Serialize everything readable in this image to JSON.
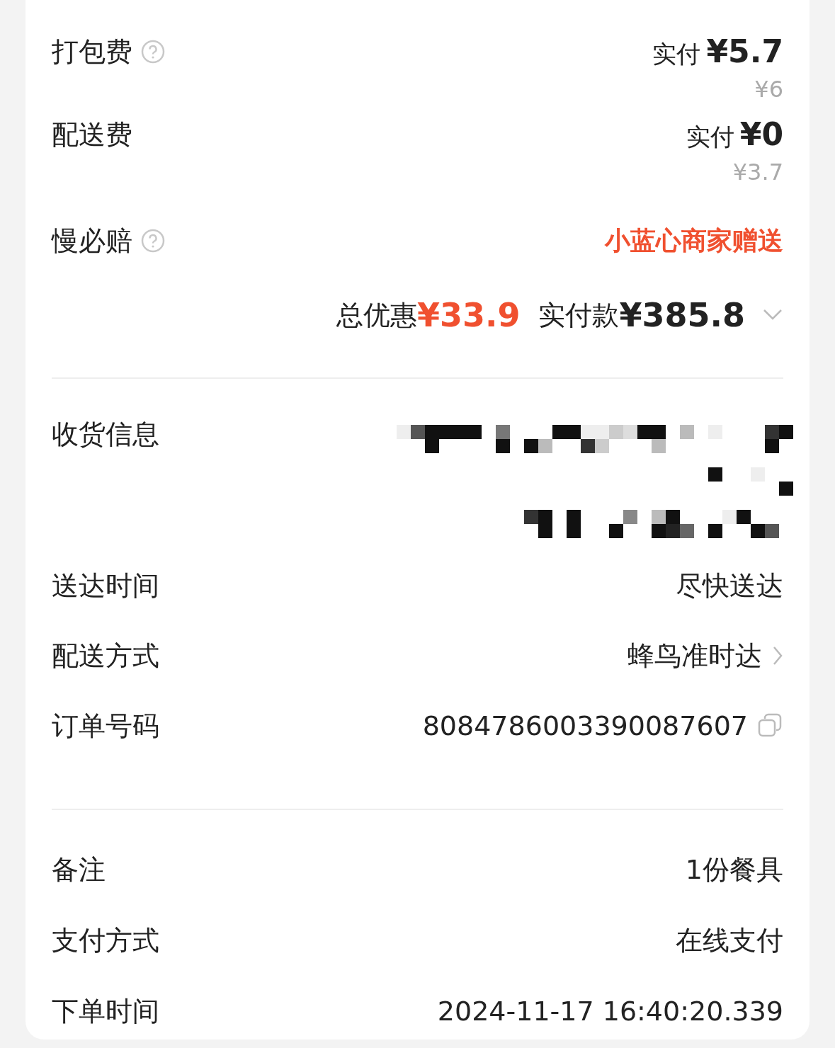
{
  "fees": [
    {
      "kind": "price",
      "label": "打包费",
      "help": true,
      "paid_label": "实付",
      "paid": "¥5.7",
      "original": "¥6"
    },
    {
      "kind": "price",
      "label": "配送费",
      "help": false,
      "paid_label": "实付",
      "paid": "¥0",
      "original": "¥3.7"
    },
    {
      "kind": "highlight",
      "label": "慢必赔",
      "help": true,
      "value": "小蓝心商家赠送"
    }
  ],
  "summary": {
    "discount_label": "总优惠",
    "discount": "¥33.9",
    "total_label": "实付款",
    "total": "¥385.8",
    "expanded": false
  },
  "details": [
    {
      "kind": "redacted",
      "label": "收货信息"
    },
    {
      "kind": "text",
      "label": "送达时间",
      "value": "尽快送达"
    },
    {
      "kind": "link",
      "label": "配送方式",
      "value": "蜂鸟准时达"
    },
    {
      "kind": "copy",
      "label": "订单号码",
      "value": "8084786003390087607"
    }
  ],
  "extra": [
    {
      "label": "备注",
      "value": "1份餐具"
    },
    {
      "label": "支付方式",
      "value": "在线支付"
    },
    {
      "label": "下单时间",
      "value": "2024-11-17 16:40:20.339"
    }
  ]
}
